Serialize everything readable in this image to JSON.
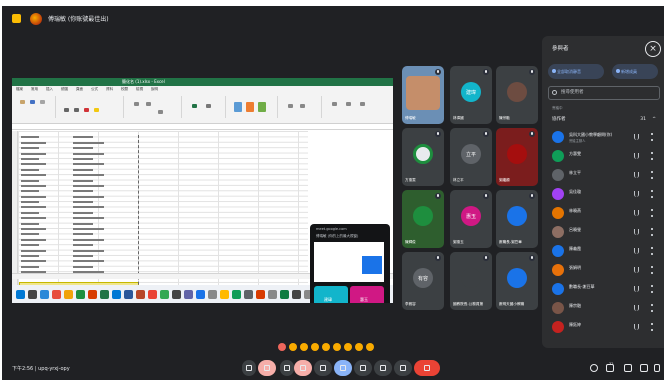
{
  "topbar": {
    "title": "傅瑞敏 (你账號最佳出)"
  },
  "share": {
    "window_title": "簡化名 (1).xlsx - Excel",
    "menu": [
      "檔案",
      "常用",
      "插入",
      "繪圖",
      "頁面",
      "公式",
      "資料",
      "校閱",
      "檢視",
      "說明"
    ],
    "phone": {
      "url": "meet.google.com",
      "heading": "傅瑞敏 (你的上的最大視窗)",
      "tile_names": [
        "建瑋",
        "惠玉"
      ]
    }
  },
  "tiles": [
    {
      "name": "傅瑞敏",
      "initials": "",
      "color": "#5f6368"
    },
    {
      "name": "林偉國",
      "initials": "建瑋",
      "color": "#12b5cb"
    },
    {
      "name": "陳宗融",
      "initials": "",
      "color": "#6d4c41"
    },
    {
      "name": "方惠雯",
      "initials": "",
      "color": "#e8eaed"
    },
    {
      "name": "林立平",
      "initials": "立平",
      "color": "#5f6368"
    },
    {
      "name": "謝繼顧",
      "initials": "",
      "color": "#a50e0e"
    },
    {
      "name": "陳輝俊",
      "initials": "",
      "color": "#1e8e3e"
    },
    {
      "name": "謝惠玉",
      "initials": "惠玉",
      "color": "#d01884"
    },
    {
      "name": "數職長-謝豆華",
      "initials": "",
      "color": "#1a73e8"
    },
    {
      "name": "李雅容",
      "initials": "有容",
      "color": "#5f6368"
    },
    {
      "name": "國教院長-公務員第",
      "initials": "",
      "color": "#3c4043"
    },
    {
      "name": "數明天國小教職",
      "initials": "",
      "color": "#1a73e8"
    }
  ],
  "panel": {
    "title": "參與者",
    "btn_add": "全部取消靜音",
    "btn_new": "新增成員",
    "search_placeholder": "搜尋使用者",
    "section": "會議中",
    "group": {
      "label": "協作者",
      "count": "31"
    },
    "people": [
      {
        "name": "吳科大國小教學顧問(你)",
        "sub": "會議主辦人",
        "color": "#1a73e8"
      },
      {
        "name": "方惠雯",
        "sub": "",
        "color": "#0f9d58"
      },
      {
        "name": "林立平",
        "sub": "",
        "color": "#5f6368"
      },
      {
        "name": "吳佳璇",
        "sub": "",
        "color": "#a142f4"
      },
      {
        "name": "林曉燕",
        "sub": "",
        "color": "#e37400"
      },
      {
        "name": "呂曉瑩",
        "sub": "",
        "color": "#8d6e63"
      },
      {
        "name": "陳義霞",
        "sub": "",
        "color": "#1a73e8"
      },
      {
        "name": "張娟明",
        "sub": "",
        "color": "#e8710a"
      },
      {
        "name": "數職長-謝豆華",
        "sub": "",
        "color": "#1a73e8"
      },
      {
        "name": "陳宗融",
        "sub": "",
        "color": "#795548"
      },
      {
        "name": "陳鈺婷",
        "sub": "",
        "color": "#c5221f"
      }
    ]
  },
  "bottom": {
    "time": "下午2:56",
    "code": "upq-yrxj-opy",
    "participant_count": "32"
  }
}
